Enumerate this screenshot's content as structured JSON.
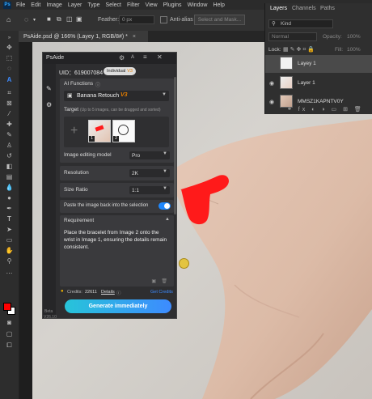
{
  "app": {
    "logo": "Ps"
  },
  "menu": [
    "File",
    "Edit",
    "Image",
    "Layer",
    "Type",
    "Select",
    "Filter",
    "View",
    "Plugins",
    "Window",
    "Help"
  ],
  "options": {
    "feather_label": "Feather:",
    "feather_value": "0 px",
    "antialias_label": "Anti-alias",
    "select_mask_label": "Select and Mask..."
  },
  "document": {
    "tab_title": "PsAide.psd @ 166% (Layey 1, RGB/8#) *",
    "close": "×"
  },
  "layers_panel": {
    "tabs": [
      "Layers",
      "Channels",
      "Paths"
    ],
    "filter_kind": "Kind",
    "blend_mode": "Normal",
    "opacity_label": "Opacity:",
    "opacity_value": "100%",
    "lock_label": "Lock:",
    "fill_label": "Fill:",
    "fill_value": "100%",
    "layers": [
      {
        "name": "Layey 1"
      },
      {
        "name": "Layer 1"
      },
      {
        "name": "MMSZ1KAPNTV0Y"
      }
    ]
  },
  "plugin": {
    "title": "PsAide",
    "uid": "UID：619007084",
    "badge": "Individual",
    "badge_version": "V3",
    "ai_functions_label": "AI Functions",
    "function_value": "Banana Retouch",
    "function_version": "V3",
    "target_label": "Target",
    "target_hint": "(Up to 5 images, can be dragged and sorted)",
    "thumb_badges": [
      "1",
      "2"
    ],
    "model_label": "Image editing model",
    "model_value": "Pro",
    "resolution_label": "Resolution",
    "resolution_value": "2K",
    "size_label": "Size Ratio",
    "size_value": "1:1",
    "paste_label": "Paste the image back into the selection",
    "paste_on": true,
    "requirement_label": "Requirement",
    "requirement_text": "Place the bracelet from Image 2 onto the wrist in Image 1, ensuring the details remain consistent.",
    "credits_label": "Credits:",
    "credits_value": "22611",
    "details_link": "Details",
    "get_credits": "Get Credits",
    "generate_label": "Generate immediately",
    "beta_label": "Beta",
    "version_label": "V26.10"
  },
  "colors": {
    "accent": "#3d8bff",
    "toggle": "#1e88ff",
    "stroke_red": "#ff1a1a",
    "foreground": "#ff0000",
    "background": "#ffffff"
  }
}
